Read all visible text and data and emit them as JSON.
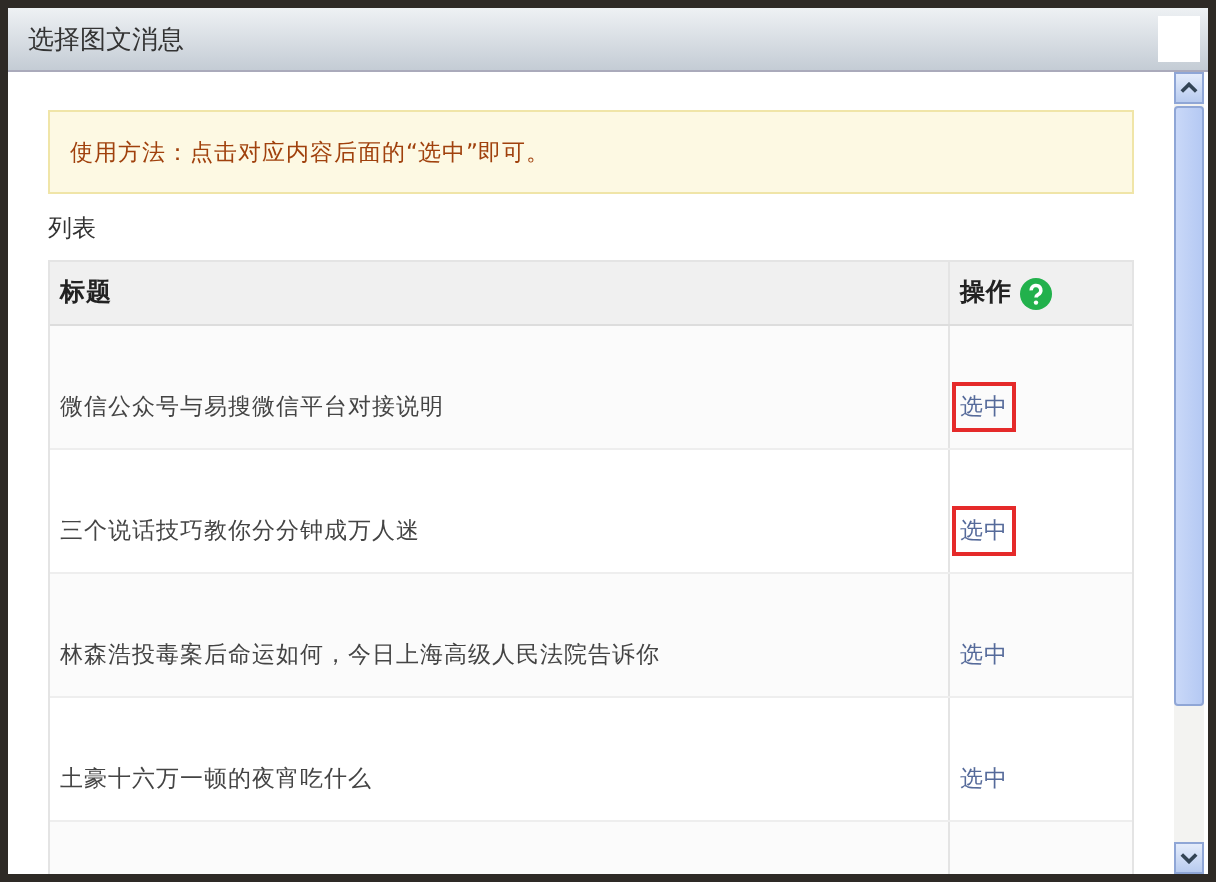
{
  "window": {
    "title": "选择图文消息"
  },
  "notice": "使用方法：点击对应内容后面的“选中”即可。",
  "section_label": "列表",
  "table": {
    "columns": [
      "标题",
      "操作"
    ],
    "rows": [
      {
        "title": "微信公众号与易搜微信平台对接说明",
        "action": "选中",
        "highlighted": true
      },
      {
        "title": "三个说话技巧教你分分钟成万人迷",
        "action": "选中",
        "highlighted": true
      },
      {
        "title": "林森浩投毒案后命运如何，今日上海高级人民法院告诉你",
        "action": "选中",
        "highlighted": false
      },
      {
        "title": "土豪十六万一顿的夜宵吃什么",
        "action": "选中",
        "highlighted": false
      }
    ]
  }
}
